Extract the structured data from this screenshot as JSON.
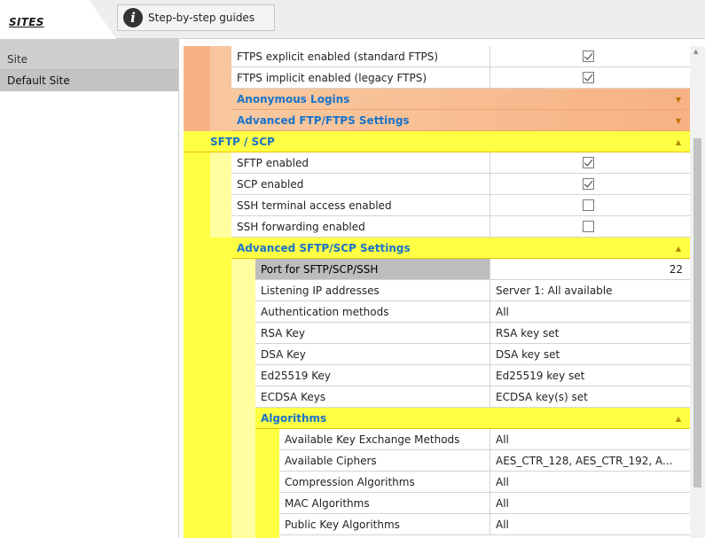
{
  "tabs": {
    "sites_label": "SITES",
    "guides_label": "Step-by-step guides",
    "guides_icon": "info-icon"
  },
  "sidebar": {
    "header": "Site",
    "items": [
      {
        "label": "Default Site"
      }
    ]
  },
  "ftps": {
    "rows": [
      {
        "label": "FTPS explicit enabled (standard FTPS)",
        "checked": true
      },
      {
        "label": "FTPS implicit enabled (legacy FTPS)",
        "checked": true
      }
    ],
    "anon_label": "Anonymous Logins",
    "advanced_label": "Advanced FTP/FTPS Settings"
  },
  "sftp": {
    "section_label": "SFTP / SCP",
    "rows": [
      {
        "label": "SFTP enabled",
        "checked": true
      },
      {
        "label": "SCP enabled",
        "checked": true
      },
      {
        "label": "SSH terminal access enabled",
        "checked": false
      },
      {
        "label": "SSH forwarding enabled",
        "checked": false
      }
    ],
    "advanced": {
      "label": "Advanced SFTP/SCP Settings",
      "rows": [
        {
          "label": "Port for SFTP/SCP/SSH",
          "value": "22"
        },
        {
          "label": "Listening IP addresses",
          "value": "Server 1: All available"
        },
        {
          "label": "Authentication methods",
          "value": "All"
        },
        {
          "label": "RSA Key",
          "value": "RSA key set"
        },
        {
          "label": "DSA Key",
          "value": "DSA key set"
        },
        {
          "label": "Ed25519 Key",
          "value": "Ed25519 key set"
        },
        {
          "label": "ECDSA Keys",
          "value": "ECDSA key(s) set"
        }
      ],
      "algorithms": {
        "label": "Algorithms",
        "rows": [
          {
            "label": "Available Key Exchange Methods",
            "value": "All"
          },
          {
            "label": "Available Ciphers",
            "value": "AES_CTR_128, AES_CTR_192, A..."
          },
          {
            "label": "Compression Algorithms",
            "value": "All"
          },
          {
            "label": "MAC Algorithms",
            "value": "All"
          },
          {
            "label": "Public Key Algorithms",
            "value": "All"
          }
        ]
      }
    }
  },
  "colors": {
    "orange_section": "#f7b184",
    "yellow_section": "#ffff44",
    "section_text": "#1a73c8"
  }
}
